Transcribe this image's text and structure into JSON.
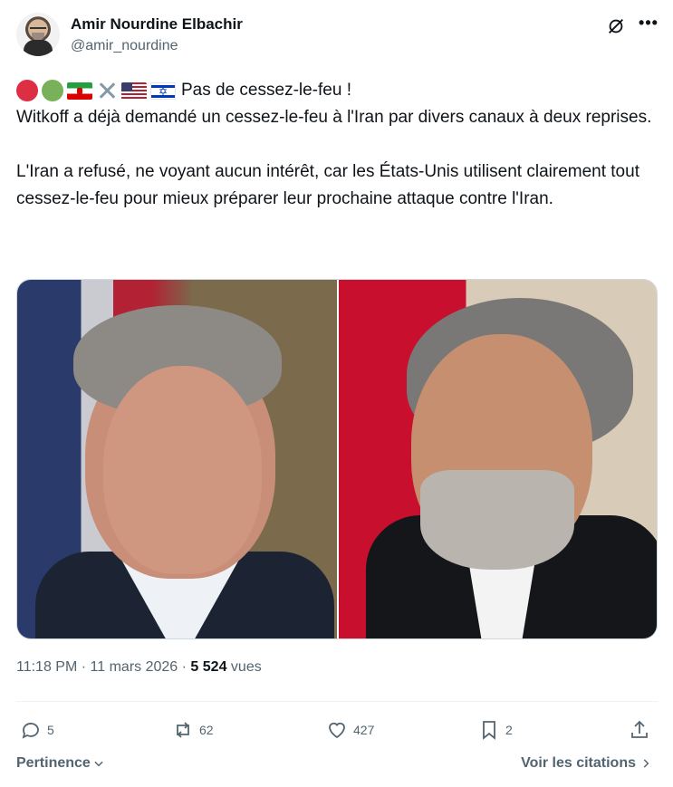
{
  "author": {
    "name": "Amir Nourdine Elbachir",
    "handle": "@amir_nourdine"
  },
  "tweet": {
    "headline": "Pas de cessez-le-feu !",
    "line1": "Witkoff a déjà demandé un cessez-le-feu à l'Iran par divers canaux à deux reprises.",
    "line2": "L'Iran a refusé, ne voyant aucun intérêt, car les États-Unis utilisent clairement tout cessez-le-feu pour mieux préparer leur prochaine attaque contre l'Iran.",
    "emojis": [
      "red-circle",
      "green-circle",
      "iran-flag",
      "crossed-swords",
      "usa-flag",
      "israel-flag"
    ]
  },
  "meta": {
    "time": "11:18 PM",
    "separator": "·",
    "date": "11 mars 2026",
    "views_count": "5 524",
    "views_label": "vues"
  },
  "actions": {
    "replies": "5",
    "reposts": "62",
    "likes": "427",
    "bookmarks": "2"
  },
  "footer": {
    "sort_label": "Pertinence",
    "quotes_label": "Voir les citations"
  },
  "colors": {
    "text_primary": "#0f1419",
    "text_secondary": "#536471",
    "divider": "#eff3f4"
  },
  "icons": [
    "grok-icon",
    "more-icon",
    "reply-icon",
    "repost-icon",
    "like-icon",
    "bookmark-icon",
    "share-icon",
    "chevron-down-icon",
    "chevron-right-icon"
  ]
}
